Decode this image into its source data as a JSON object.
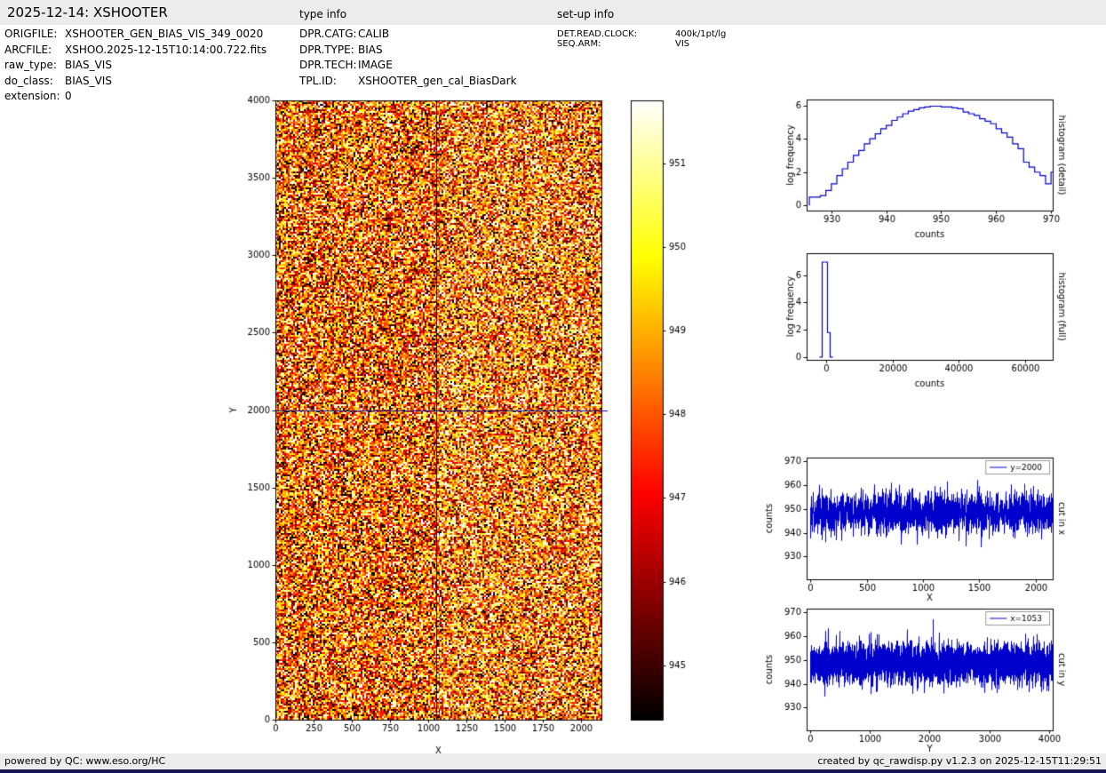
{
  "header": {
    "title": "2025-12-14: XSHOOTER",
    "type_info_label": "type info",
    "setup_info_label": "set-up info"
  },
  "metadata": {
    "file_info": [
      {
        "label": "ORIGFILE:",
        "value": "XSHOOTER_GEN_BIAS_VIS_349_0020"
      },
      {
        "label": "ARCFILE:",
        "value": "XSHOO.2025-12-15T10:14:00.722.fits"
      },
      {
        "label": "raw_type:",
        "value": "BIAS_VIS"
      },
      {
        "label": "do_class:",
        "value": "BIAS_VIS"
      },
      {
        "label": "extension:",
        "value": "0"
      }
    ],
    "type_info": [
      {
        "label": "DPR.CATG:",
        "value": "CALIB"
      },
      {
        "label": "DPR.TYPE:",
        "value": "BIAS"
      },
      {
        "label": "DPR.TECH:",
        "value": "IMAGE"
      },
      {
        "label": "TPL.ID:",
        "value": "XSHOOTER_gen_cal_BiasDark"
      }
    ],
    "setup_info": [
      {
        "label": "DET.READ.CLOCK:",
        "value": "400k/1pt/lg"
      },
      {
        "label": "SEQ.ARM:",
        "value": "VIS"
      }
    ]
  },
  "footer": {
    "left": "powered by QC: www.eso.org/HC",
    "right": "created by qc_rawdisp.py v1.2.3 on 2025-12-15T11:29:51"
  },
  "chart_data": [
    {
      "id": "bias-image",
      "type": "heatmap",
      "xlabel": "X",
      "ylabel": "Y",
      "xlim": [
        0,
        2134
      ],
      "ylim": [
        0,
        4000
      ],
      "xticks": [
        0,
        250,
        500,
        750,
        1000,
        1250,
        1500,
        1750,
        2000
      ],
      "yticks": [
        0,
        500,
        1000,
        1500,
        2000,
        2500,
        3000,
        3500,
        4000
      ],
      "colormap": "hot",
      "noise_mean_counts": 948.2,
      "noise_sigma_counts": 3.1,
      "right_half_brightness_offset_counts": 0.8,
      "crosshair": {
        "x": 1053,
        "y": 2000,
        "color": "#00008b"
      }
    },
    {
      "id": "colorbar-main",
      "type": "colorbar",
      "colormap": "hot",
      "vmin": 944.35,
      "vmax": 951.75,
      "ticks": [
        945,
        946,
        947,
        948,
        949,
        950,
        951
      ]
    },
    {
      "id": "histogram-detail",
      "type": "histogram-step",
      "side_label": "histogram (detail)",
      "xlabel": "counts",
      "ylabel": "log frequency",
      "xlim": [
        925.5,
        970.3
      ],
      "ylim": [
        -0.3,
        6.35
      ],
      "xticks": [
        930,
        940,
        950,
        960,
        970
      ],
      "yticks": [
        0,
        2,
        4,
        6
      ],
      "bin_start": 926,
      "bin_width": 1,
      "log_freq": [
        0.5,
        0.5,
        0.6,
        0.9,
        1.3,
        1.8,
        2.2,
        2.6,
        3.0,
        3.3,
        3.7,
        4.0,
        4.3,
        4.6,
        4.8,
        5.1,
        5.3,
        5.5,
        5.65,
        5.75,
        5.85,
        5.9,
        5.95,
        5.95,
        5.9,
        5.9,
        5.85,
        5.8,
        5.6,
        5.5,
        5.4,
        5.2,
        5.05,
        4.9,
        4.6,
        4.35,
        4.1,
        3.7,
        3.4,
        2.6,
        2.3,
        2.0,
        1.8,
        1.3,
        2.0
      ],
      "color": "#0000cd"
    },
    {
      "id": "histogram-full",
      "type": "histogram-step",
      "side_label": "histogram (full)",
      "xlabel": "counts",
      "ylabel": "log frequency",
      "xlim": [
        -5900,
        68400
      ],
      "ylim": [
        -0.2,
        7.6
      ],
      "xticks": [
        0,
        20000,
        40000,
        60000
      ],
      "yticks": [
        0,
        2,
        4,
        6
      ],
      "bin_start": -2000,
      "bin_width": 800,
      "log_freq": [
        0,
        6.95,
        6.95,
        1.8,
        0
      ],
      "color": "#0000cd"
    },
    {
      "id": "cut-in-x",
      "type": "noisy-line",
      "side_label": "cut in x",
      "legend": "y=2000",
      "xlabel": "X",
      "ylabel": "counts",
      "xlim": [
        -32,
        2151
      ],
      "ylim": [
        920.5,
        971.5
      ],
      "xticks": [
        0,
        500,
        1000,
        1500,
        2000
      ],
      "yticks": [
        930,
        940,
        950,
        960,
        970
      ],
      "n": 2144,
      "mean": 948.2,
      "sigma": 4.2,
      "seed": 7,
      "spikes": [
        {
          "x": 130,
          "v": 936
        },
        {
          "x": 1210,
          "v": 961.5
        },
        {
          "x": 1900,
          "v": 960.5
        }
      ],
      "color": "#0000cd"
    },
    {
      "id": "cut-in-y",
      "type": "noisy-line",
      "side_label": "cut in y",
      "legend": "x=1053",
      "xlabel": "Y",
      "ylabel": "counts",
      "xlim": [
        -58,
        4062
      ],
      "ylim": [
        920.5,
        971.5
      ],
      "xticks": [
        0,
        1000,
        2000,
        3000,
        4000
      ],
      "yticks": [
        930,
        940,
        950,
        960,
        970
      ],
      "n": 4060,
      "mean": 948.5,
      "sigma": 4.0,
      "seed": 13,
      "spikes": [
        {
          "x": 2050,
          "v": 967
        },
        {
          "x": 980,
          "v": 961
        },
        {
          "x": 3600,
          "v": 961
        }
      ],
      "color": "#0000cd"
    }
  ]
}
